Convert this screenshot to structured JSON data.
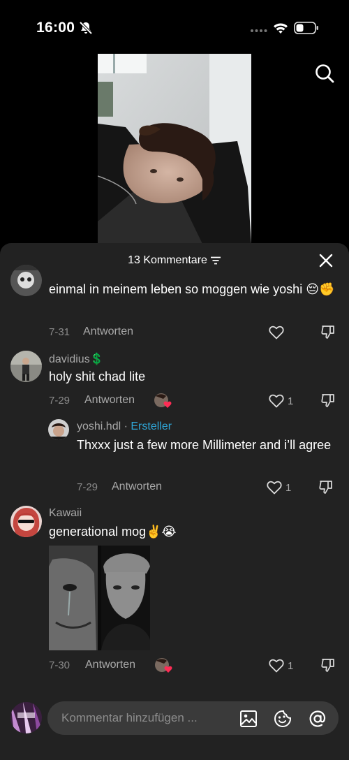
{
  "status_bar": {
    "time": "16:00"
  },
  "sheet": {
    "title": "13 Kommentare"
  },
  "comments": [
    {
      "text": "einmal in meinem leben so moggen wie yoshi 😔✊",
      "date": "7-31",
      "reply_label": "Antworten",
      "likes": ""
    },
    {
      "author": "davidius💲",
      "text": "holy shit chad lite",
      "date": "7-29",
      "reply_label": "Antworten",
      "likes": "1",
      "reply": {
        "author": "yoshi.hdl",
        "separator": " · ",
        "badge": "Ersteller",
        "text": "Thxxx just a few more Millimeter and i’ll agree",
        "date": "7-29",
        "reply_label": "Antworten",
        "likes": "1"
      }
    },
    {
      "author": "Kawaii",
      "text": "generational mog✌️😭",
      "date": "7-30",
      "reply_label": "Antworten",
      "likes": "1"
    }
  ],
  "composer": {
    "placeholder": "Kommentar hinzufügen ..."
  },
  "icons": [
    "bell-off-icon",
    "signal-icon",
    "wifi-icon",
    "battery-icon",
    "search-icon",
    "filter-icon",
    "close-icon",
    "heart-icon",
    "dislike-icon",
    "image-icon",
    "emoji-icon",
    "at-icon"
  ],
  "colors": {
    "sheet_bg": "#222222",
    "creator_badge": "#2fa6d8",
    "heart_red": "#fe2c55"
  }
}
